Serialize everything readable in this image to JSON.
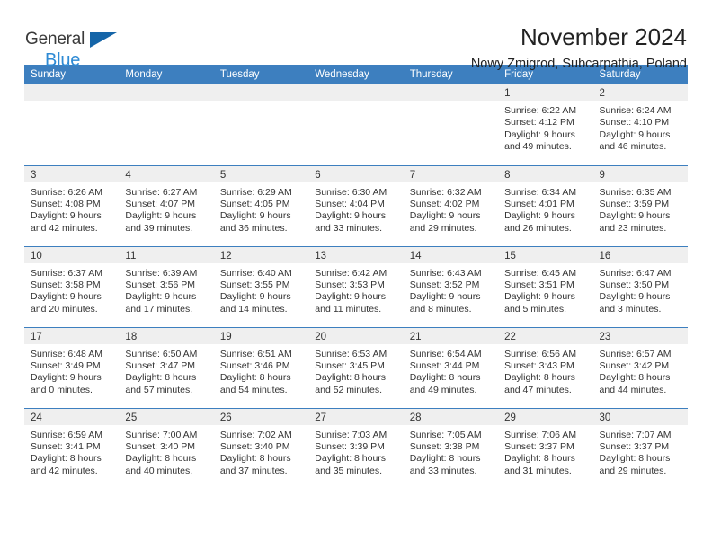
{
  "brand": {
    "name_top": "General",
    "name_bottom": "Blue",
    "logo_icon": "blue-triangle-flag-icon",
    "accent_color": "#2e8ad4",
    "flag_color": "#1565a8"
  },
  "header": {
    "title": "November 2024",
    "location": "Nowy Zmigrod, Subcarpathia, Poland"
  },
  "calendar": {
    "header_color": "#3d7fbf",
    "daynum_bg": "#efefef",
    "weekday_headers": [
      "Sunday",
      "Monday",
      "Tuesday",
      "Wednesday",
      "Thursday",
      "Friday",
      "Saturday"
    ],
    "weeks": [
      [
        {
          "day": "",
          "lines": []
        },
        {
          "day": "",
          "lines": []
        },
        {
          "day": "",
          "lines": []
        },
        {
          "day": "",
          "lines": []
        },
        {
          "day": "",
          "lines": []
        },
        {
          "day": "1",
          "lines": [
            "Sunrise: 6:22 AM",
            "Sunset: 4:12 PM",
            "Daylight: 9 hours",
            "and 49 minutes."
          ]
        },
        {
          "day": "2",
          "lines": [
            "Sunrise: 6:24 AM",
            "Sunset: 4:10 PM",
            "Daylight: 9 hours",
            "and 46 minutes."
          ]
        }
      ],
      [
        {
          "day": "3",
          "lines": [
            "Sunrise: 6:26 AM",
            "Sunset: 4:08 PM",
            "Daylight: 9 hours",
            "and 42 minutes."
          ]
        },
        {
          "day": "4",
          "lines": [
            "Sunrise: 6:27 AM",
            "Sunset: 4:07 PM",
            "Daylight: 9 hours",
            "and 39 minutes."
          ]
        },
        {
          "day": "5",
          "lines": [
            "Sunrise: 6:29 AM",
            "Sunset: 4:05 PM",
            "Daylight: 9 hours",
            "and 36 minutes."
          ]
        },
        {
          "day": "6",
          "lines": [
            "Sunrise: 6:30 AM",
            "Sunset: 4:04 PM",
            "Daylight: 9 hours",
            "and 33 minutes."
          ]
        },
        {
          "day": "7",
          "lines": [
            "Sunrise: 6:32 AM",
            "Sunset: 4:02 PM",
            "Daylight: 9 hours",
            "and 29 minutes."
          ]
        },
        {
          "day": "8",
          "lines": [
            "Sunrise: 6:34 AM",
            "Sunset: 4:01 PM",
            "Daylight: 9 hours",
            "and 26 minutes."
          ]
        },
        {
          "day": "9",
          "lines": [
            "Sunrise: 6:35 AM",
            "Sunset: 3:59 PM",
            "Daylight: 9 hours",
            "and 23 minutes."
          ]
        }
      ],
      [
        {
          "day": "10",
          "lines": [
            "Sunrise: 6:37 AM",
            "Sunset: 3:58 PM",
            "Daylight: 9 hours",
            "and 20 minutes."
          ]
        },
        {
          "day": "11",
          "lines": [
            "Sunrise: 6:39 AM",
            "Sunset: 3:56 PM",
            "Daylight: 9 hours",
            "and 17 minutes."
          ]
        },
        {
          "day": "12",
          "lines": [
            "Sunrise: 6:40 AM",
            "Sunset: 3:55 PM",
            "Daylight: 9 hours",
            "and 14 minutes."
          ]
        },
        {
          "day": "13",
          "lines": [
            "Sunrise: 6:42 AM",
            "Sunset: 3:53 PM",
            "Daylight: 9 hours",
            "and 11 minutes."
          ]
        },
        {
          "day": "14",
          "lines": [
            "Sunrise: 6:43 AM",
            "Sunset: 3:52 PM",
            "Daylight: 9 hours",
            "and 8 minutes."
          ]
        },
        {
          "day": "15",
          "lines": [
            "Sunrise: 6:45 AM",
            "Sunset: 3:51 PM",
            "Daylight: 9 hours",
            "and 5 minutes."
          ]
        },
        {
          "day": "16",
          "lines": [
            "Sunrise: 6:47 AM",
            "Sunset: 3:50 PM",
            "Daylight: 9 hours",
            "and 3 minutes."
          ]
        }
      ],
      [
        {
          "day": "17",
          "lines": [
            "Sunrise: 6:48 AM",
            "Sunset: 3:49 PM",
            "Daylight: 9 hours",
            "and 0 minutes."
          ]
        },
        {
          "day": "18",
          "lines": [
            "Sunrise: 6:50 AM",
            "Sunset: 3:47 PM",
            "Daylight: 8 hours",
            "and 57 minutes."
          ]
        },
        {
          "day": "19",
          "lines": [
            "Sunrise: 6:51 AM",
            "Sunset: 3:46 PM",
            "Daylight: 8 hours",
            "and 54 minutes."
          ]
        },
        {
          "day": "20",
          "lines": [
            "Sunrise: 6:53 AM",
            "Sunset: 3:45 PM",
            "Daylight: 8 hours",
            "and 52 minutes."
          ]
        },
        {
          "day": "21",
          "lines": [
            "Sunrise: 6:54 AM",
            "Sunset: 3:44 PM",
            "Daylight: 8 hours",
            "and 49 minutes."
          ]
        },
        {
          "day": "22",
          "lines": [
            "Sunrise: 6:56 AM",
            "Sunset: 3:43 PM",
            "Daylight: 8 hours",
            "and 47 minutes."
          ]
        },
        {
          "day": "23",
          "lines": [
            "Sunrise: 6:57 AM",
            "Sunset: 3:42 PM",
            "Daylight: 8 hours",
            "and 44 minutes."
          ]
        }
      ],
      [
        {
          "day": "24",
          "lines": [
            "Sunrise: 6:59 AM",
            "Sunset: 3:41 PM",
            "Daylight: 8 hours",
            "and 42 minutes."
          ]
        },
        {
          "day": "25",
          "lines": [
            "Sunrise: 7:00 AM",
            "Sunset: 3:40 PM",
            "Daylight: 8 hours",
            "and 40 minutes."
          ]
        },
        {
          "day": "26",
          "lines": [
            "Sunrise: 7:02 AM",
            "Sunset: 3:40 PM",
            "Daylight: 8 hours",
            "and 37 minutes."
          ]
        },
        {
          "day": "27",
          "lines": [
            "Sunrise: 7:03 AM",
            "Sunset: 3:39 PM",
            "Daylight: 8 hours",
            "and 35 minutes."
          ]
        },
        {
          "day": "28",
          "lines": [
            "Sunrise: 7:05 AM",
            "Sunset: 3:38 PM",
            "Daylight: 8 hours",
            "and 33 minutes."
          ]
        },
        {
          "day": "29",
          "lines": [
            "Sunrise: 7:06 AM",
            "Sunset: 3:37 PM",
            "Daylight: 8 hours",
            "and 31 minutes."
          ]
        },
        {
          "day": "30",
          "lines": [
            "Sunrise: 7:07 AM",
            "Sunset: 3:37 PM",
            "Daylight: 8 hours",
            "and 29 minutes."
          ]
        }
      ]
    ]
  }
}
